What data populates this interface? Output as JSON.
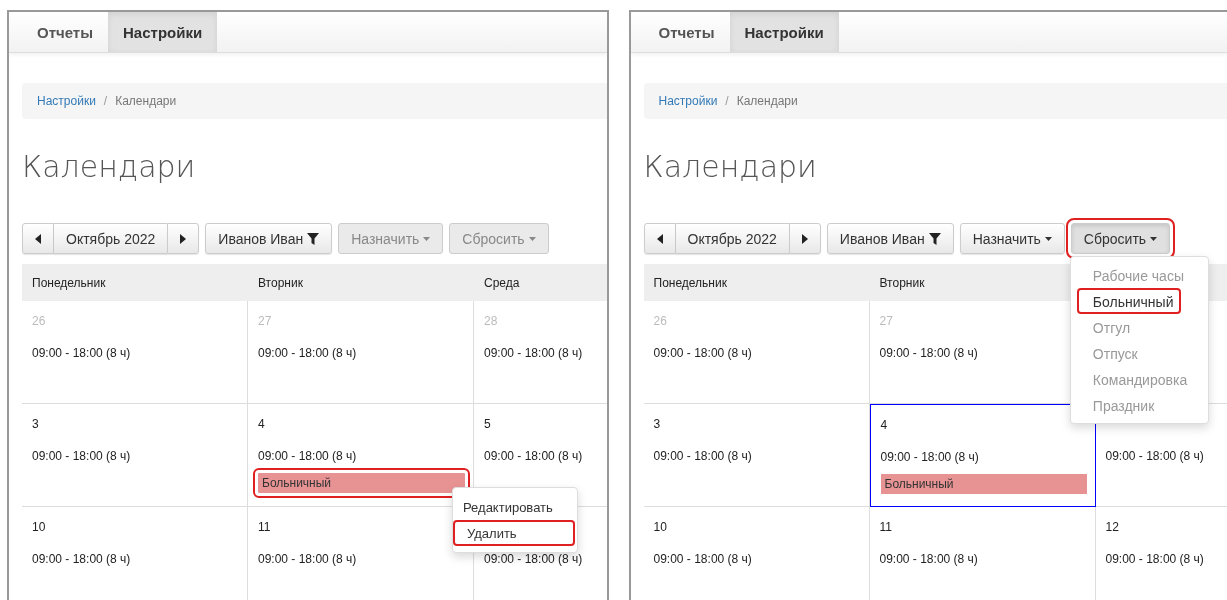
{
  "panels": [
    {
      "tabs": [
        {
          "label": "Отчеты",
          "selected": false
        },
        {
          "label": "Настройки",
          "selected": true
        }
      ],
      "breadcrumb": {
        "link": "Настройки",
        "separator": "/",
        "current": "Календари"
      },
      "title": "Календари",
      "toolbar": {
        "month": "Октябрь 2022",
        "user": "Иванов Иван",
        "buttons": [
          {
            "label": "Назначить",
            "disabled": true,
            "highlighted": false
          },
          {
            "label": "Сбросить",
            "disabled": true,
            "highlighted": false
          }
        ]
      },
      "calendar": {
        "columns": [
          "Понедельник",
          "Вторник",
          "Среда"
        ],
        "weeks": [
          [
            {
              "day": "26",
              "other_month": true,
              "hours": "09:00 - 18:00 (8 ч)",
              "selected": false
            },
            {
              "day": "27",
              "other_month": true,
              "hours": "09:00 - 18:00 (8 ч)",
              "selected": false
            },
            {
              "day": "28",
              "other_month": true,
              "hours": "09:00 - 18:00 (8 ч)",
              "selected": false
            }
          ],
          [
            {
              "day": "3",
              "other_month": false,
              "hours": "09:00 - 18:00 (8 ч)",
              "selected": false
            },
            {
              "day": "4",
              "other_month": false,
              "hours": "09:00 - 18:00 (8 ч)",
              "selected": false,
              "event": {
                "label": "Больничный",
                "highlighted": true,
                "menu": [
                  {
                    "label": "Редактировать",
                    "highlighted": false
                  },
                  {
                    "label": "Удалить",
                    "highlighted": true
                  }
                ]
              }
            },
            {
              "day": "5",
              "other_month": false,
              "hours": "09:00 - 18:00 (8 ч)",
              "selected": false
            }
          ],
          [
            {
              "day": "10",
              "other_month": false,
              "hours": "09:00 - 18:00 (8 ч)",
              "selected": false
            },
            {
              "day": "11",
              "other_month": false,
              "hours": "09:00 - 18:00 (8 ч)",
              "selected": false
            },
            {
              "hours": "09:00 - 18:00 (8 ч)",
              "selected": false
            }
          ]
        ]
      }
    },
    {
      "tabs": [
        {
          "label": "Отчеты",
          "selected": false
        },
        {
          "label": "Настройки",
          "selected": true
        }
      ],
      "breadcrumb": {
        "link": "Настройки",
        "separator": "/",
        "current": "Календари"
      },
      "title": "Календари",
      "toolbar": {
        "month": "Октябрь 2022",
        "user": "Иванов Иван",
        "buttons": [
          {
            "label": "Назначить",
            "disabled": false,
            "highlighted": false
          },
          {
            "label": "Сбросить",
            "disabled": false,
            "highlighted": true,
            "dropdown": [
              {
                "label": "Рабочие часы",
                "disabled": true,
                "highlighted": false
              },
              {
                "label": "Больничный",
                "disabled": false,
                "highlighted": true
              },
              {
                "label": "Отгул",
                "disabled": true,
                "highlighted": false
              },
              {
                "label": "Отпуск",
                "disabled": true,
                "highlighted": false
              },
              {
                "label": "Командировка",
                "disabled": true,
                "highlighted": false
              },
              {
                "label": "Праздник",
                "disabled": true,
                "highlighted": false
              }
            ]
          }
        ]
      },
      "calendar": {
        "columns": [
          "Понедельник",
          "Вторник"
        ],
        "weeks": [
          [
            {
              "day": "26",
              "other_month": true,
              "hours": "09:00 - 18:00 (8 ч)",
              "selected": false
            },
            {
              "day": "27",
              "other_month": true,
              "hours": "09:00 - 18:00 (8 ч)",
              "selected": false
            }
          ],
          [
            {
              "day": "3",
              "other_month": false,
              "hours": "09:00 - 18:00 (8 ч)",
              "selected": false
            },
            {
              "day": "4",
              "other_month": false,
              "hours": "09:00 - 18:00 (8 ч)",
              "selected": true,
              "event": {
                "label": "Больничный",
                "highlighted": false
              }
            },
            {
              "hours": "09:00 - 18:00 (8 ч)",
              "selected": false
            }
          ],
          [
            {
              "day": "10",
              "other_month": false,
              "hours": "09:00 - 18:00 (8 ч)",
              "selected": false
            },
            {
              "day": "11",
              "other_month": false,
              "hours": "09:00 - 18:00 (8 ч)",
              "selected": false
            },
            {
              "day": "12",
              "other_month": false,
              "hours": "09:00 - 18:00 (8 ч)",
              "selected": false
            }
          ]
        ]
      }
    }
  ]
}
